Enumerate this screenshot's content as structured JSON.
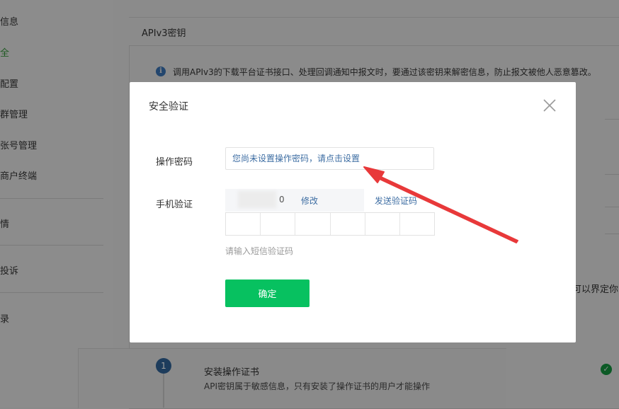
{
  "sidebar": {
    "items": [
      {
        "label": "信息"
      },
      {
        "label": "全"
      },
      {
        "label": "配置"
      },
      {
        "label": "群管理"
      },
      {
        "label": "张号管理"
      },
      {
        "label": "商户终端"
      },
      {
        "label": "情"
      },
      {
        "label": "投诉"
      },
      {
        "label": "录"
      }
    ],
    "active_index": 1
  },
  "main": {
    "section_title": "APIv3密钥",
    "info_icon": "info-icon",
    "info_text": "调用APIv3的下载平台证书接口、处理回调通知中报文时，要通过该密钥来解密信息，防止报文被他人恶意篡改。",
    "side_snippet": "可以界定你",
    "step": {
      "number": "1",
      "title": "安装操作证书",
      "description": "API密钥属于敏感信息，只有安装了操作证书的用户才能操作",
      "status_icon": "check-circle-icon"
    }
  },
  "modal": {
    "title": "安全验证",
    "close_icon": "close-icon",
    "password_label": "操作密码",
    "password_prompt": "您尚未设置操作密码，请点击设置",
    "phone_label": "手机验证",
    "phone_suffix": "0",
    "modify_label": "修改",
    "send_code_label": "发送验证码",
    "code_cells": 6,
    "code_hint": "请输入短信验证码",
    "confirm_label": "确定"
  },
  "colors": {
    "accent": "#07c160",
    "link": "#3e6ea3",
    "annotation_arrow": "#e8393a"
  }
}
